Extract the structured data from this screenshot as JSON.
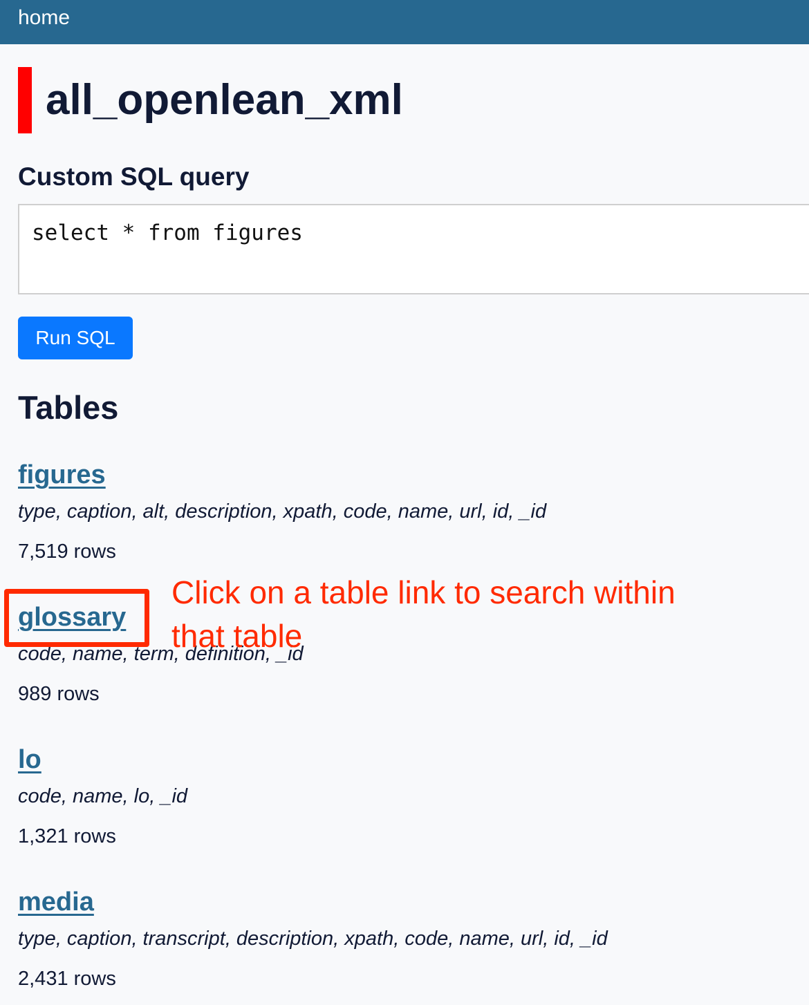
{
  "header": {
    "home_link": "home"
  },
  "database": {
    "title": "all_openlean_xml",
    "accent_color": "#ff0000"
  },
  "query": {
    "heading": "Custom SQL query",
    "sql": "select * from figures",
    "run_button": "Run SQL"
  },
  "tables_section": {
    "heading": "Tables",
    "tables": [
      {
        "name": "figures",
        "columns": "type, caption, alt, description, xpath, code, name, url, id, _id",
        "rows": "7,519 rows"
      },
      {
        "name": "glossary",
        "columns": "code, name, term, definition, _id",
        "rows": "989 rows"
      },
      {
        "name": "lo",
        "columns": "code, name, lo, _id",
        "rows": "1,321 rows"
      },
      {
        "name": "media",
        "columns": "type, caption, transcript, description, xpath, code, name, url, id, _id",
        "rows": "2,431 rows"
      }
    ]
  },
  "annotation": {
    "text": "Click on a table link to search within that table",
    "color": "#ff2a00"
  },
  "colors": {
    "header_bg": "#276890",
    "link": "#276890",
    "button_bg": "#0a78ff",
    "text": "#111a35",
    "page_bg": "#f8f9fb"
  }
}
